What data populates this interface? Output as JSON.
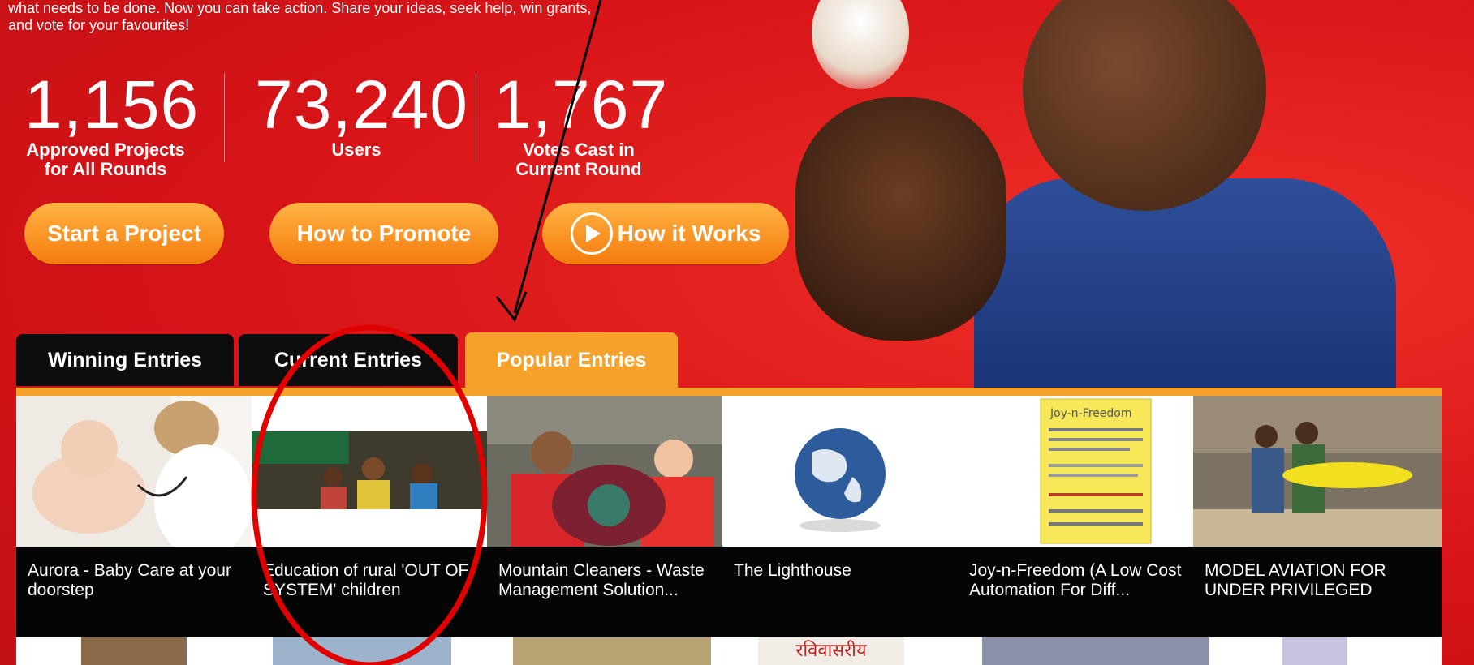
{
  "intro": {
    "line1": "what needs to be done. Now you can take action. Share your ideas, seek help, win grants,",
    "line2": "and vote for your favourites!"
  },
  "stats": [
    {
      "number": "1,156",
      "label_line1": "Approved Projects",
      "label_line2": "for All Rounds"
    },
    {
      "number": "73,240",
      "label_line1": "Users",
      "label_line2": ""
    },
    {
      "number": "1,767",
      "label_line1": "Votes Cast in",
      "label_line2": "Current Round"
    }
  ],
  "actions": {
    "start": "Start a Project",
    "promote": "How to Promote",
    "works": "How it Works"
  },
  "tabs": [
    {
      "label": "Winning Entries",
      "active": false
    },
    {
      "label": "Current Entries",
      "active": false
    },
    {
      "label": "Popular Entries",
      "active": true
    }
  ],
  "entries": [
    {
      "title": "Aurora - Baby Care at your doorstep"
    },
    {
      "title": "Education of rural 'OUT OF SYSTEM' children"
    },
    {
      "title": "Mountain Cleaners - Waste Management Solution..."
    },
    {
      "title": "The Lighthouse"
    },
    {
      "title": "Joy-n-Freedom (A Low Cost Automation For Diff..."
    },
    {
      "title": "MODEL AVIATION FOR UNDER PRIVILEGED"
    }
  ],
  "thumb_text": {
    "joy_poster_title": "Joy-n-Freedom",
    "row2_sign": "रविवासरीय"
  },
  "colors": {
    "background": "#e0141c",
    "accent_orange": "#f5a12a",
    "caption_bg": "#050505",
    "annotation_red": "#e00000"
  }
}
